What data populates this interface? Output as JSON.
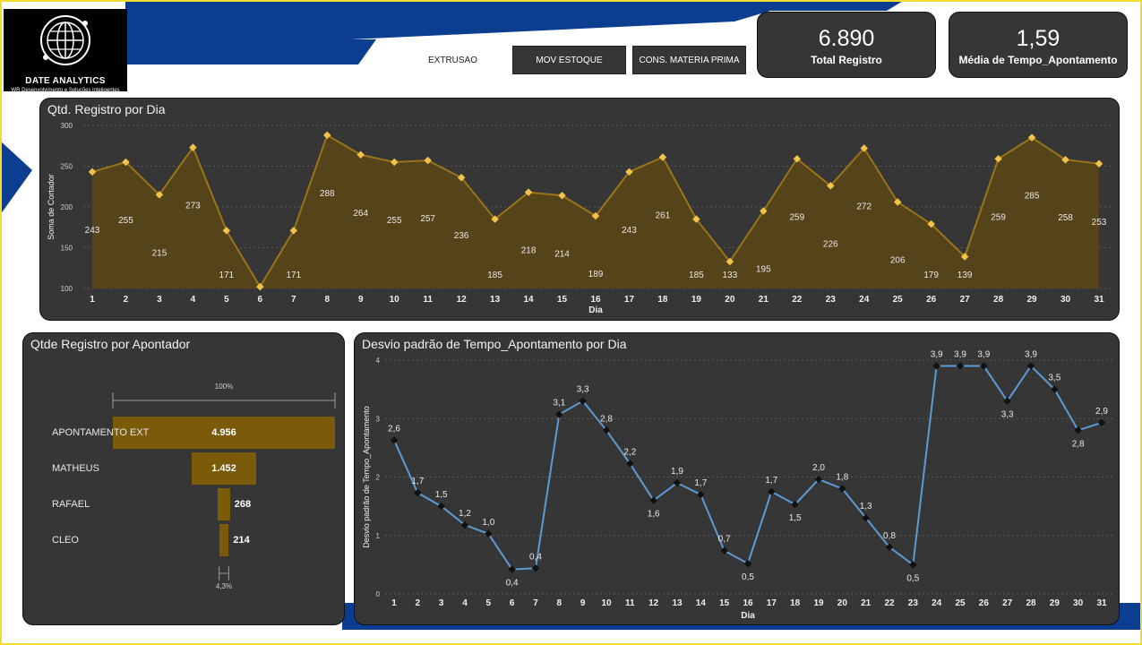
{
  "header": {
    "logo_name": "DATE ANALYTICS",
    "logo_tagline": "WR Desenvolvimento e Soluções inteligentes",
    "nav_text": "EXTRUSAO",
    "nav_buttons": [
      "MOV ESTOQUE",
      "CONS. MATERIA PRIMA"
    ]
  },
  "kpis": [
    {
      "value": "6.890",
      "label": "Total Registro"
    },
    {
      "value": "1,59",
      "label": "Média de Tempo_Apontamento"
    }
  ],
  "colors": {
    "card_bg": "#363636",
    "area_line": "#9a7419",
    "area_fill": "#574519",
    "area_marker": "#f2c34a",
    "funnel_bar": "#7b5a0a",
    "std_line": "#5b9bd5",
    "brand_blue": "#0b3d91"
  },
  "chart_data": [
    {
      "type": "area",
      "title": "Qtd. Registro por Dia",
      "xlabel": "Dia",
      "ylabel": "Soma de Cortador",
      "ylim": [
        100,
        300
      ],
      "yticks": [
        100,
        150,
        200,
        250,
        300
      ],
      "grid": true,
      "categories": [
        1,
        2,
        3,
        4,
        5,
        6,
        7,
        8,
        9,
        10,
        11,
        12,
        13,
        14,
        15,
        16,
        17,
        18,
        19,
        20,
        21,
        22,
        23,
        24,
        25,
        26,
        27,
        28,
        29,
        30,
        31
      ],
      "values": [
        243,
        255,
        215,
        273,
        171,
        102,
        171,
        288,
        264,
        255,
        257,
        236,
        185,
        218,
        214,
        189,
        243,
        261,
        185,
        133,
        195,
        259,
        226,
        272,
        206,
        179,
        139,
        259,
        285,
        258,
        253
      ],
      "data_labels": [
        "243",
        "255",
        "215",
        "273",
        "171",
        "",
        "171",
        "288",
        "264",
        "255",
        "257",
        "236",
        "185",
        "218",
        "214",
        "189",
        "243",
        "261",
        "185",
        "133",
        "195",
        "259",
        "226",
        "272",
        "206",
        "179",
        "139",
        "259",
        "285",
        "258",
        "253"
      ]
    },
    {
      "type": "bar",
      "title": "Qtde Registro por Apontador",
      "top_percent_label": "100%",
      "bottom_percent_label": "4,3%",
      "categories": [
        "APONTAMENTO EXT",
        "MATHEUS",
        "RAFAEL",
        "CLEO"
      ],
      "values": [
        4956,
        1452,
        268,
        214
      ],
      "value_labels": [
        "4.956",
        "1.452",
        "268",
        "214"
      ]
    },
    {
      "type": "line",
      "title": "Desvio padrão de Tempo_Apontamento por Dia",
      "xlabel": "Dia",
      "ylabel": "Desvio padrão de Tempo_Apontamento",
      "ylim": [
        0,
        4
      ],
      "yticks": [
        0,
        1,
        2,
        3,
        4
      ],
      "grid": true,
      "categories": [
        1,
        2,
        3,
        4,
        5,
        6,
        7,
        8,
        9,
        10,
        11,
        12,
        13,
        14,
        15,
        16,
        17,
        18,
        19,
        20,
        21,
        22,
        23,
        24,
        25,
        26,
        27,
        28,
        29,
        30,
        31
      ],
      "values": [
        2.63,
        1.73,
        1.5,
        1.18,
        1.03,
        0.42,
        0.44,
        3.07,
        3.3,
        2.8,
        2.23,
        1.6,
        1.9,
        1.7,
        0.74,
        0.52,
        1.75,
        1.53,
        1.96,
        1.8,
        1.3,
        0.8,
        0.5,
        3.9,
        3.9,
        3.9,
        3.3,
        3.9,
        3.5,
        2.8,
        2.93
      ],
      "data_labels": [
        "2,6",
        "1,7",
        "1,5",
        "1,2",
        "1,0",
        "0,4",
        "0,4",
        "3,1",
        "3,3",
        "2,8",
        "2,2",
        "1,6",
        "1,9",
        "1,7",
        "0,7",
        "0,5",
        "1,7",
        "1,5",
        "2,0",
        "1,8",
        "1,3",
        "0,8",
        "0,5",
        "3,9",
        "3,9",
        "3,9",
        "3,3",
        "3,9",
        "3,5",
        "2,8",
        "2,9"
      ]
    }
  ]
}
